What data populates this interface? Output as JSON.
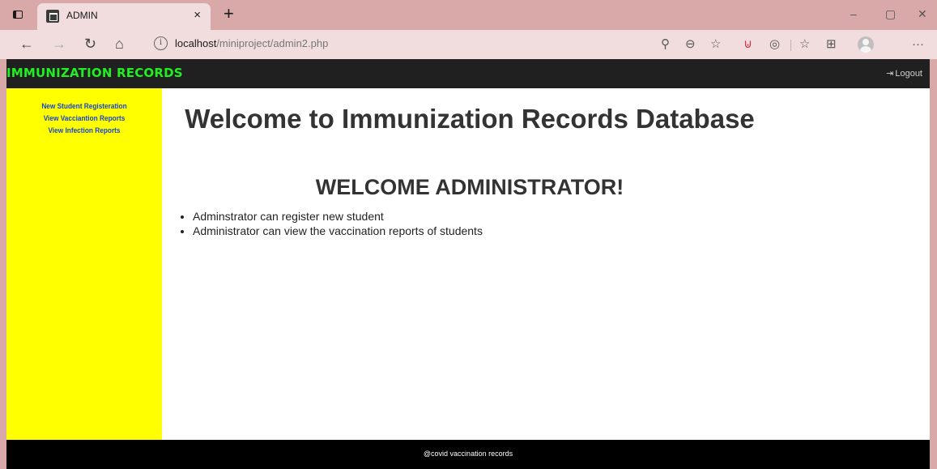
{
  "browser": {
    "tab_title": "ADMIN",
    "tab_close": "×",
    "new_tab": "+",
    "url_host": "localhost",
    "url_path": "/miniproject/admin2.php",
    "window_controls": {
      "minimize": "–",
      "restore": "▢",
      "close": "✕"
    },
    "toolbar_icons": {
      "back": "←",
      "forward": "→",
      "reload": "↻",
      "home": "⌂",
      "more": "···"
    }
  },
  "nav": {
    "brand": "IMMUNIZATION RECORDS",
    "logout": "Logout",
    "brand_color": "#22ee22"
  },
  "sidebar": {
    "background": "#ffff00",
    "links": [
      {
        "label": "New Student Registeration"
      },
      {
        "label": "View Vacciantion Reports"
      },
      {
        "label": "View Infection Reports"
      }
    ]
  },
  "main": {
    "title": "Welcome to Immunization Records Database",
    "subtitle": "WELCOME ADMINISTRATOR!",
    "bullets": [
      "Adminstrator can register new student",
      "Administrator can view the vaccination reports of students"
    ]
  },
  "footer": {
    "text": "@covid vaccination records"
  }
}
